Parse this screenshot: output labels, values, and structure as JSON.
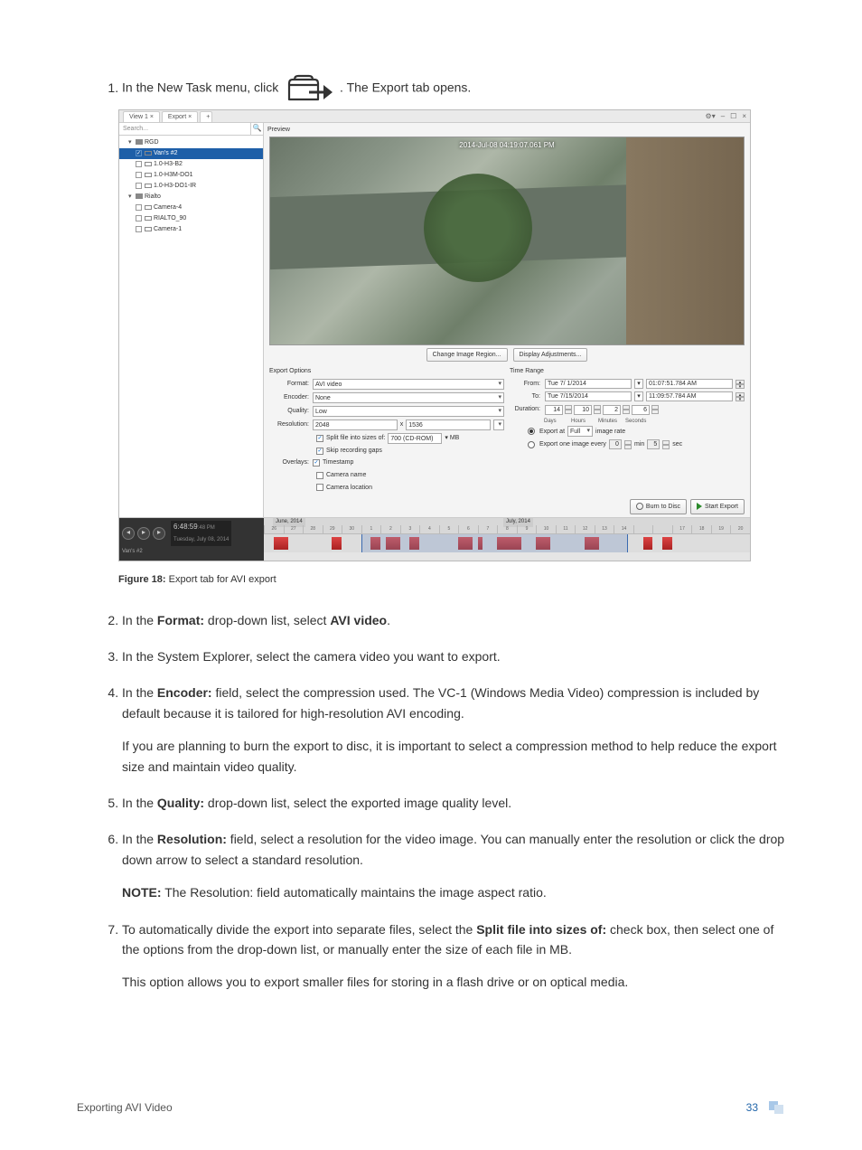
{
  "steps": {
    "s1a": "In the New Task menu, click ",
    "s1b": ". The Export tab opens.",
    "s2a": "In the ",
    "s2bold": "Format:",
    "s2b": " drop-down list, select ",
    "s2bold2": "AVI video",
    "s2c": ".",
    "s3": "In the System Explorer, select the camera video you want to export.",
    "s4a": "In the ",
    "s4bold": "Encoder:",
    "s4b": " field, select the compression used. The VC-1 (Windows Media Video) compression is included by default because it is tailored for high-resolution AVI encoding.",
    "s4p": "If you are planning to burn the export to disc, it is important to select a compression method to help reduce the export size and maintain video quality.",
    "s5a": "In the ",
    "s5bold": "Quality:",
    "s5b": " drop-down list, select the exported image quality level.",
    "s6a": "In the ",
    "s6bold": "Resolution:",
    "s6b": " field, select a resolution for the video image. You can manually enter the resolution or click the drop down arrow to select a standard resolution.",
    "s6notebold": "NOTE:",
    "s6note": " The Resolution: field automatically maintains the image aspect ratio.",
    "s7a": "To automatically divide the export into separate files, select the ",
    "s7bold": "Split file into sizes of:",
    "s7b": " check box, then select one of the options from the drop-down list, or manually enter the size of each file in MB.",
    "s7p": "This option allows you to export smaller files for storing in a flash drive or on optical media."
  },
  "figcap": {
    "bold": "Figure 18:",
    "text": " Export tab for AVI export"
  },
  "footer": {
    "section": "Exporting AVI Video",
    "page": "33"
  },
  "ui": {
    "tabs": {
      "view": "View 1 ×",
      "export": "Export ×"
    },
    "winctrl": {
      "gear": "⚙▾",
      "min": "–",
      "max": "☐",
      "close": "×"
    },
    "search_ph": "Search...",
    "tree": {
      "rgd": "RGD",
      "vans": "Van's #2",
      "cam1": "1.0-H3-B2",
      "cam2": "1.0-H3M-DO1",
      "cam3": "1.0-H3-DO1-IR",
      "rialto": "Rialto",
      "r1": "Camera-4",
      "r2": "RIALTO_90",
      "r3": "Camera-1"
    },
    "preview": {
      "label": "Preview",
      "timestamp": "2014-Jul-08 04:19:07.061 PM",
      "btn1": "Change Image Region...",
      "btn2": "Display Adjustments..."
    },
    "opts": {
      "title": "Export Options",
      "format_l": "Format:",
      "format_v": "AVI video",
      "encoder_l": "Encoder:",
      "encoder_v": "None",
      "quality_l": "Quality:",
      "quality_v": "Low",
      "res_l": "Resolution:",
      "res_w": "2048",
      "res_h": "1536",
      "split_l": "Split file into sizes of:",
      "split_v": "700 (CD-ROM)",
      "split_u": "▾ MB",
      "skip": "Skip recording gaps",
      "overlays_l": "Overlays:",
      "ov1": "Timestamp",
      "ov2": "Camera name",
      "ov3": "Camera location"
    },
    "tr": {
      "title": "Time Range",
      "from_l": "From:",
      "from_d": "Tue  7/ 1/2014",
      "from_t": "01:07:51.784 AM",
      "to_l": "To:",
      "to_d": "Tue  7/15/2014",
      "to_t": "11:09:57.784 AM",
      "dur_l": "Duration:",
      "d": "14",
      "h": "10",
      "m": "2",
      "s": "6",
      "days": "Days",
      "hours": "Hours",
      "mins": "Minutes",
      "secs": "Seconds",
      "rate_a": "Export at",
      "rate_v": "Full",
      "rate_b": "image rate",
      "every_a": "Export one image every",
      "ev_m": "0",
      "ev_ml": "min",
      "ev_s": "5",
      "ev_sl": "sec"
    },
    "fbtn": {
      "burn": "Burn to Disc",
      "start": "Start Export"
    },
    "tl": {
      "time": "6:48:59",
      "tz": ":48 PM",
      "date": "Tuesday, July 08, 2014",
      "cam": "Van's #2",
      "m1": "June, 2014",
      "m2": "July, 2014"
    }
  }
}
